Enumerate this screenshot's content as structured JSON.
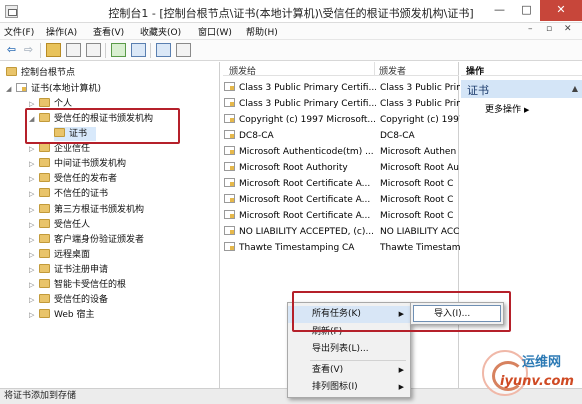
{
  "window": {
    "title": "控制台1 - [控制台根节点\\证书(本地计算机)\\受信任的根证书颁发机构\\证书]",
    "minimize": "—",
    "maximize": "□",
    "close": "✕"
  },
  "menu": {
    "items": [
      "文件(F)",
      "操作(A)",
      "查看(V)",
      "收藏夹(O)",
      "窗口(W)",
      "帮助(H)"
    ],
    "mdi": [
      "–",
      "▫",
      "✕"
    ]
  },
  "tree": {
    "root": "控制台根节点",
    "computer": "证书(本地计算机)",
    "items": [
      "个人",
      "受信任的根证书颁发机构",
      "证书",
      "企业信任",
      "中间证书颁发机构",
      "受信任的发布者",
      "不信任的证书",
      "第三方根证书颁发机构",
      "受信任人",
      "客户端身份验证颁发者",
      "远程桌面",
      "证书注册申请",
      "智能卡受信任的根",
      "受信任的设备",
      "Web 宿主"
    ]
  },
  "list": {
    "headers": {
      "issued_to": "颁发给",
      "issued_by": "颁发者"
    },
    "rows": [
      {
        "to": "Class 3 Public Primary Certifi...",
        "by": "Class 3 Public Prim"
      },
      {
        "to": "Class 3 Public Primary Certifi...",
        "by": "Class 3 Public Prim"
      },
      {
        "to": "Copyright (c) 1997 Microsoft...",
        "by": "Copyright (c) 1997"
      },
      {
        "to": "DC8-CA",
        "by": "DC8-CA"
      },
      {
        "to": "Microsoft Authenticode(tm) ...",
        "by": "Microsoft Authen"
      },
      {
        "to": "Microsoft Root Authority",
        "by": "Microsoft Root Au"
      },
      {
        "to": "Microsoft Root Certificate A...",
        "by": "Microsoft Root C"
      },
      {
        "to": "Microsoft Root Certificate A...",
        "by": "Microsoft Root C"
      },
      {
        "to": "Microsoft Root Certificate A...",
        "by": "Microsoft Root C"
      },
      {
        "to": "NO LIABILITY ACCEPTED, (c)...",
        "by": "NO LIABILITY ACC"
      },
      {
        "to": "Thawte Timestamping CA",
        "by": "Thawte Timestamp"
      }
    ]
  },
  "actions": {
    "header": "操作",
    "section": "证书",
    "more": "更多操作"
  },
  "context_menu": {
    "items": [
      "所有任务(K)",
      "刷新(F)",
      "导出列表(L)...",
      "查看(V)",
      "排列图标(I)"
    ],
    "submenu": [
      "导入(I)..."
    ]
  },
  "status": "将证书添加到存储",
  "watermark": {
    "top": "运维网",
    "bottom": "iyunv.com"
  }
}
